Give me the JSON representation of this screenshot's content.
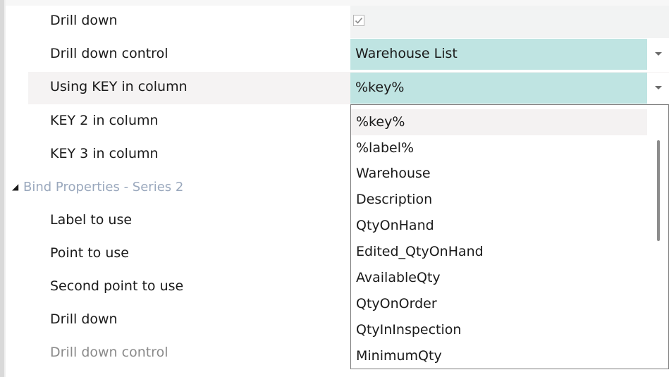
{
  "rows_series1": [
    {
      "label": "Drill down",
      "value_type": "checkbox",
      "checked": true
    },
    {
      "label": "Drill down control",
      "value": "Warehouse List"
    },
    {
      "label": "Using KEY in column",
      "value": "%key%"
    },
    {
      "label": "KEY 2 in column"
    },
    {
      "label": "KEY 3 in column"
    }
  ],
  "section_series2": {
    "title": "Bind Properties - Series 2",
    "expanded": true
  },
  "rows_series2": [
    {
      "label": "Label to use"
    },
    {
      "label": "Point to use"
    },
    {
      "label": "Second point to use"
    },
    {
      "label": "Drill down"
    },
    {
      "label": "Drill down control",
      "disabled": true
    }
  ],
  "dropdown": {
    "items": [
      "%key%",
      "%label%",
      "Warehouse",
      "Description",
      "QtyOnHand",
      "Edited_QtyOnHand",
      "AvailableQty",
      "QtyOnOrder",
      "QtyInInspection",
      "MinimumQty"
    ],
    "hovered_index": 0
  },
  "colors": {
    "value_cell": "#bfe4e2",
    "section_header_text": "#9aa8bd",
    "row_highlight": "#f5f3f3"
  }
}
